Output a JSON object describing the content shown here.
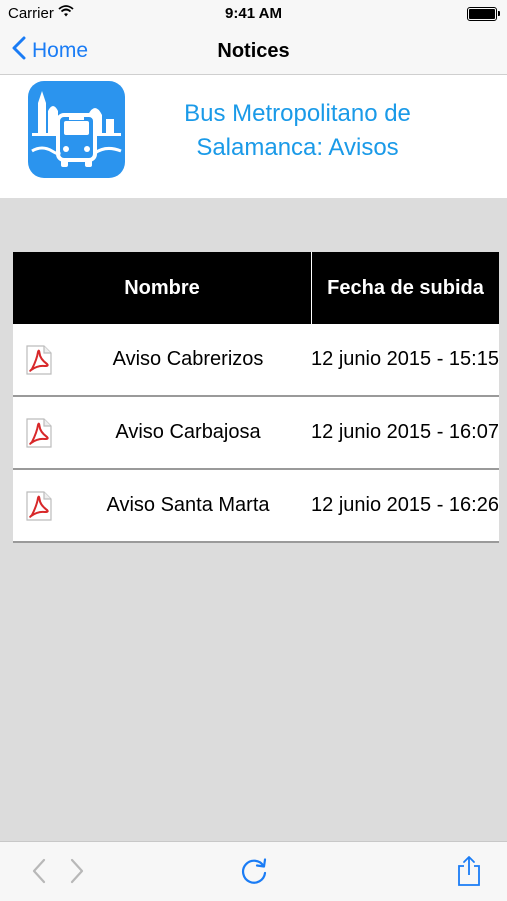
{
  "status_bar": {
    "carrier": "Carrier",
    "time": "9:41 AM"
  },
  "nav": {
    "back_label": "Home",
    "title": "Notices"
  },
  "banner": {
    "title": "Bus Metropolitano de Salamanca: Avisos"
  },
  "table": {
    "headers": {
      "name": "Nombre",
      "date": "Fecha de subida"
    },
    "rows": [
      {
        "icon": "pdf-icon",
        "name": "Aviso Cabrerizos",
        "date": "12 junio 2015 - 15:15"
      },
      {
        "icon": "pdf-icon",
        "name": "Aviso Carbajosa",
        "date": "12 junio 2015 - 16:07"
      },
      {
        "icon": "pdf-icon",
        "name": "Aviso Santa Marta",
        "date": "12 junio 2015 - 16:26"
      }
    ]
  },
  "toolbar": {
    "icons": [
      "back-arrow-icon",
      "forward-arrow-icon",
      "refresh-icon",
      "share-icon"
    ]
  },
  "colors": {
    "accent": "#1a7cf5",
    "banner_text": "#1a9ae8",
    "logo_bg": "#2b94ee",
    "pdf_red": "#d8282a",
    "header_bg": "#000000"
  }
}
